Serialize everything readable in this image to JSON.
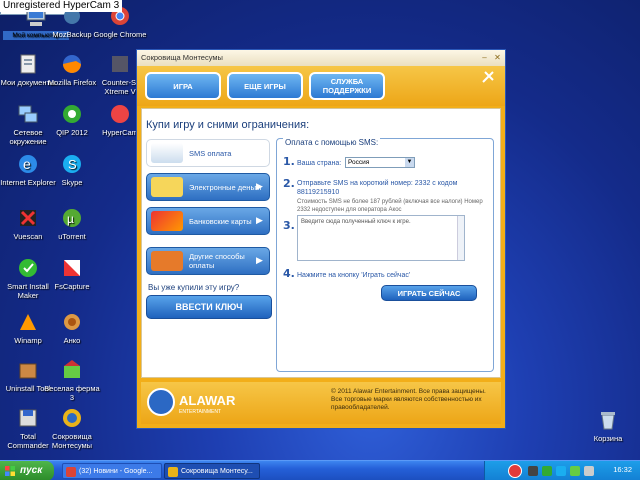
{
  "watermark": "Unregistered HyperCam 3",
  "desktop_icons": [
    {
      "id": "mycomp",
      "label": "Мой компьютер"
    },
    {
      "id": "mozbackup",
      "label": "MozBackup"
    },
    {
      "id": "chrome",
      "label": "Google Chrome"
    },
    {
      "id": "mydocs",
      "label": "Мои документы"
    },
    {
      "id": "firefox",
      "label": "Mozilla Firefox"
    },
    {
      "id": "counterstrike",
      "label": "Counter-St Xtreme V"
    },
    {
      "id": "network",
      "label": "Сетевое окружение"
    },
    {
      "id": "qip",
      "label": "QIP 2012"
    },
    {
      "id": "hypercam",
      "label": "HyperCam"
    },
    {
      "id": "ie",
      "label": "Internet Explorer"
    },
    {
      "id": "skype",
      "label": "Skype"
    },
    {
      "id": "vuescan",
      "label": "Vuescan"
    },
    {
      "id": "utorrent",
      "label": "uTorrent"
    },
    {
      "id": "smartinstall",
      "label": "Smart Install Maker"
    },
    {
      "id": "fscapture",
      "label": "FsCapture"
    },
    {
      "id": "winamp",
      "label": "Winamp"
    },
    {
      "id": "anko",
      "label": "Анко"
    },
    {
      "id": "uninstall",
      "label": "Uninstall Tool"
    },
    {
      "id": "veselaya",
      "label": "Веселая ферма 3"
    },
    {
      "id": "totalcmd",
      "label": "Total Commander"
    },
    {
      "id": "sokrovisha",
      "label": "Сокровища Монтесумы"
    },
    {
      "id": "recycle",
      "label": "Корзина"
    }
  ],
  "window": {
    "title": "Сокровища Монтесумы",
    "tabs": [
      "ИГРА",
      "ЕЩЕ ИГРЫ",
      "СЛУЖБА ПОДДЕРЖКИ"
    ],
    "heading": "Купи игру и сними ограничения:",
    "pay_methods": [
      "SMS оплата",
      "Электронные деньги",
      "Банковские карты",
      "Другие способы оплаты"
    ],
    "already_bought": "Вы уже купили эту игру?",
    "enter_key": "ВВЕСТИ КЛЮЧ",
    "sms": {
      "panel_title": "Оплата с помощью SMS:",
      "step1_num": "1.",
      "step1_label": "Ваша страна:",
      "country": "Россия",
      "step2_num": "2.",
      "step2_text": "Отправьте SMS на короткий номер: 2332 с кодом 88119215910",
      "step2_note": "Стоимость SMS не более 187 рублей (включая все налоги) Номер 2332 недоступен для оператора Акос",
      "step3_num": "3.",
      "key_placeholder": "Введите сюда полученный ключ к игре.",
      "step4_num": "4.",
      "step4_text": "Нажмите на кнопку 'Играть сейчас'",
      "play_button": "ИГРАТЬ СЕЙЧАС"
    },
    "footer": {
      "logo": "ALAWAR",
      "logo_sub": "ENTERTAINMENT",
      "copyright": "© 2011 Alawar Entertainment. Все права защищены. Все торговые марки являются собственностью их правообладателей."
    }
  },
  "taskbar": {
    "start": "пуск",
    "tasks": [
      "(32) Новини - Google...",
      "Сокровища Монтесу..."
    ],
    "lang": "EN",
    "time": "16:32"
  }
}
